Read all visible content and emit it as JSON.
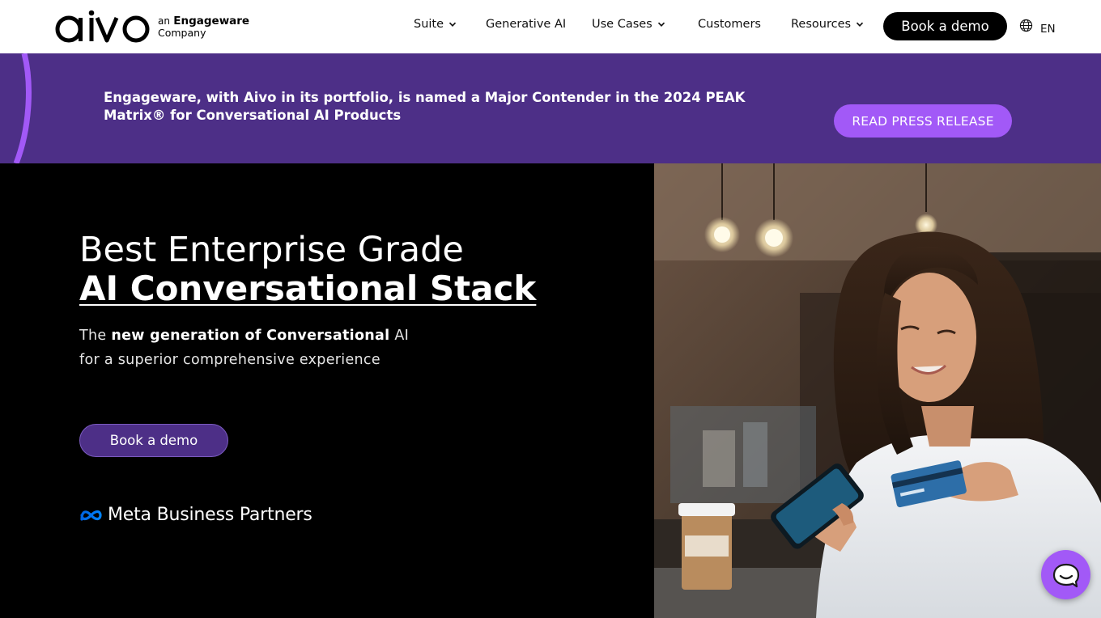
{
  "brand": {
    "logo_text": "aivo",
    "tagline_prefix": "an",
    "tagline_company": "Engageware",
    "tagline_line2": "Company"
  },
  "nav": {
    "items": [
      {
        "label": "Suite",
        "has_dropdown": true
      },
      {
        "label": "Generative AI",
        "has_dropdown": false
      },
      {
        "label": "Use Cases",
        "has_dropdown": true
      },
      {
        "label": "Customers",
        "has_dropdown": false
      },
      {
        "label": "Resources",
        "has_dropdown": true
      }
    ],
    "cta_label": "Book a demo",
    "language": "EN",
    "language_icon": "globe-icon"
  },
  "banner": {
    "text": "Engageware, with Aivo in its portfolio, is named a Major Contender in the 2024 PEAK Matrix® for Conversational AI Products",
    "button_label": "READ PRESS RELEASE"
  },
  "hero": {
    "title_line1": "Best Enterprise Grade",
    "title_line2": "AI Conversational Stack",
    "subtitle_prefix": "The",
    "subtitle_bold": "new generation of Conversational",
    "subtitle_suffix": "AI for a superior comprehensive experience",
    "cta_label": "Book a demo",
    "partner_label": "Meta Business Partners",
    "partner_icon": "meta-infinity-icon"
  },
  "chat_widget": {
    "icon": "chat-bubble-icon"
  },
  "colors": {
    "banner_bg": "#4d2f87",
    "accent_purple": "#a259f7",
    "hero_bg": "#000000",
    "header_bg": "#ffffff"
  }
}
